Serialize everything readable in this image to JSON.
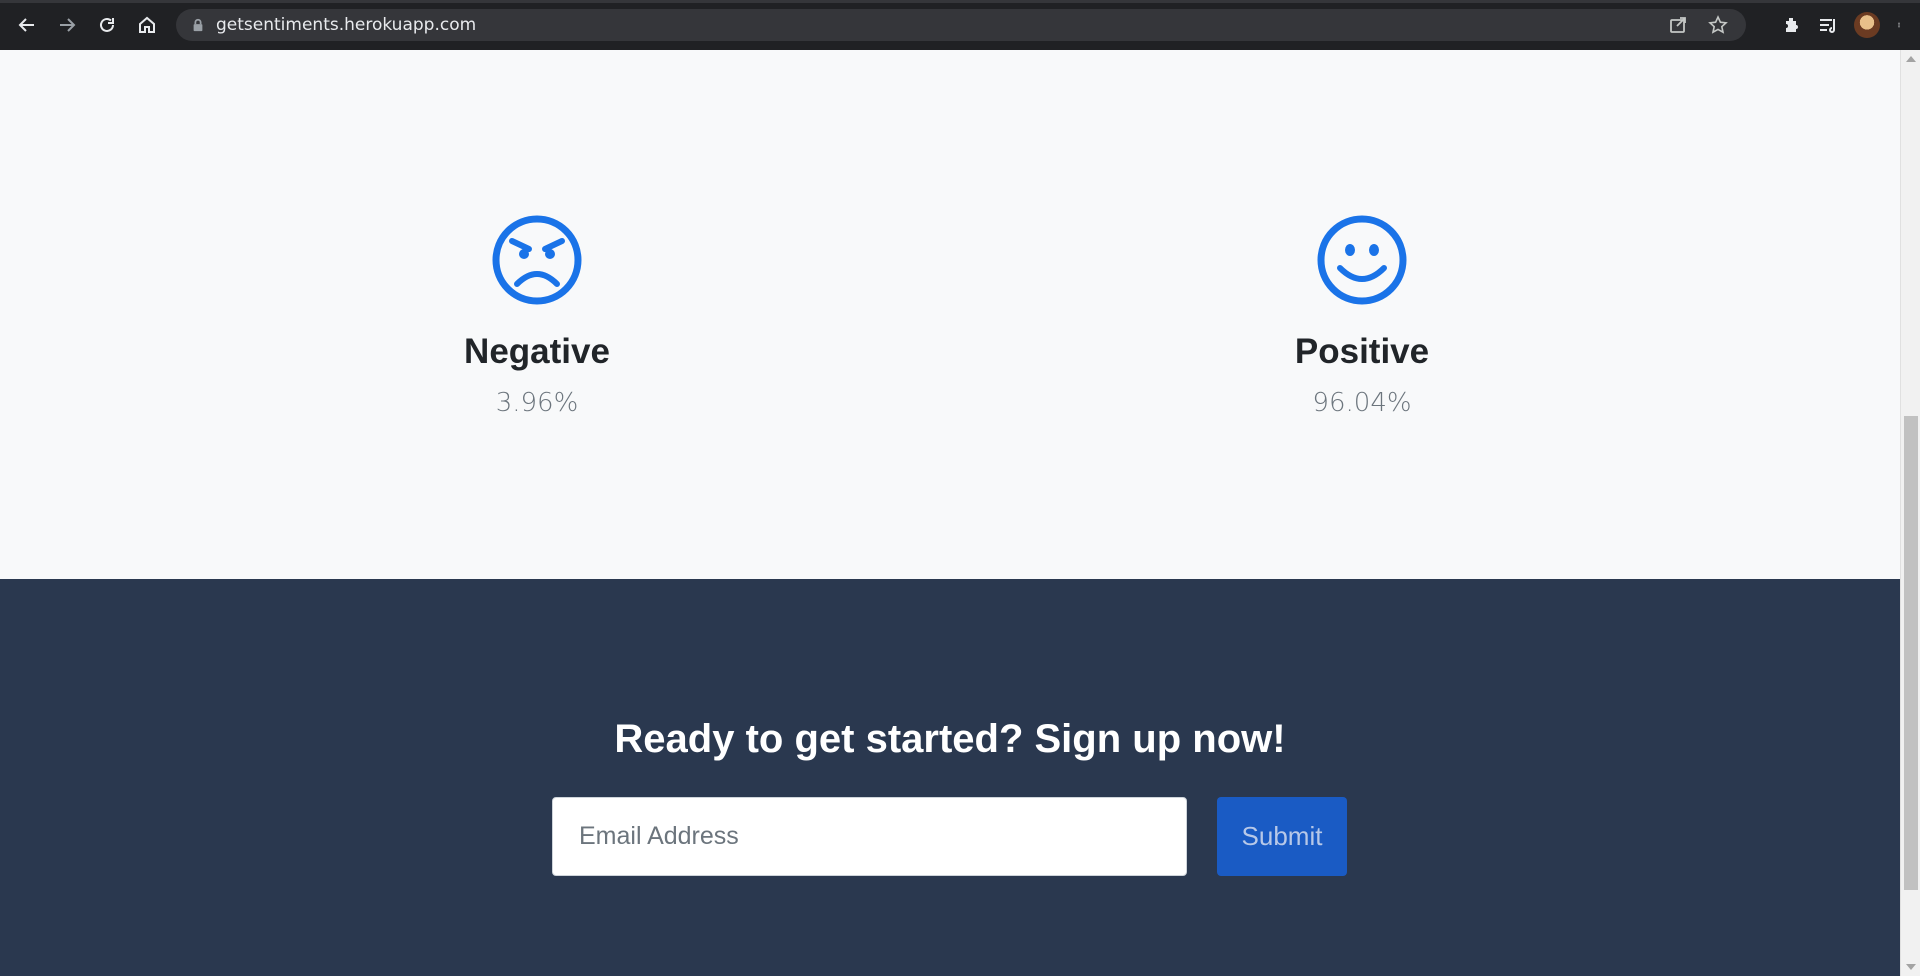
{
  "browser": {
    "url": "getsentiments.herokuapp.com",
    "icons": [
      "back-icon",
      "forward-icon",
      "reload-icon",
      "home-icon",
      "lock-icon",
      "share-icon",
      "star-icon",
      "extensions-icon",
      "reading-list-icon",
      "profile-avatar",
      "menu-icon"
    ]
  },
  "sentiments": [
    {
      "label": "Negative",
      "value": "3.96%",
      "icon": "angry-face-icon"
    },
    {
      "label": "Positive",
      "value": "96.04%",
      "icon": "smiley-face-icon"
    }
  ],
  "cta": {
    "heading": "Ready to get started? Sign up now!",
    "email_placeholder": "Email Address",
    "submit_label": "Submit"
  },
  "colors": {
    "accent": "#1a73e8",
    "cta_background": "#2a384f",
    "button": "#1a5bc4"
  }
}
